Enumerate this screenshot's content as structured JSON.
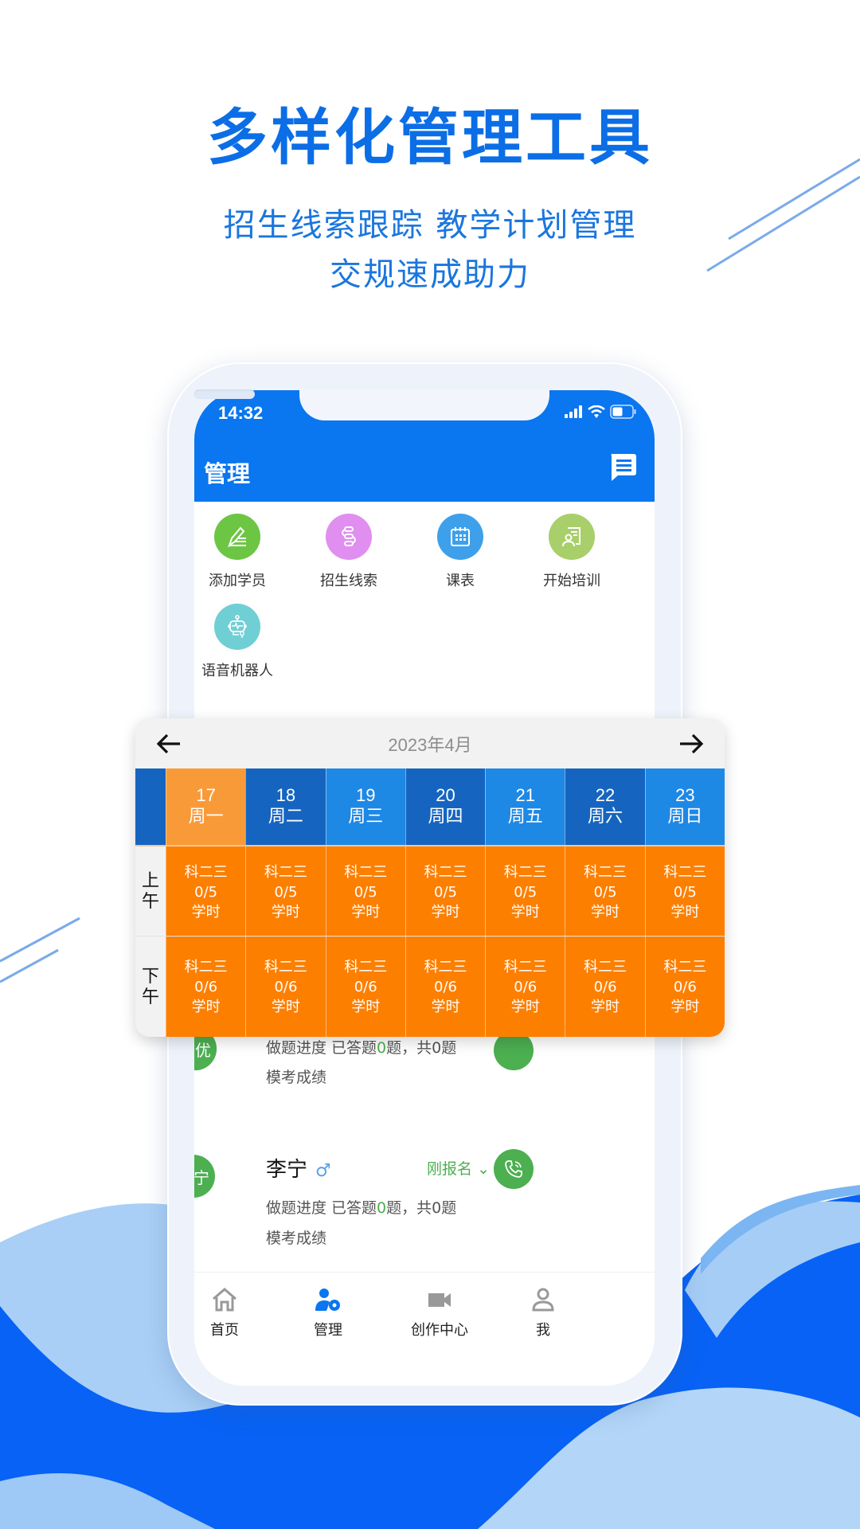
{
  "promo": {
    "headline": "多样化管理工具",
    "subline1": "招生线索跟踪 教学计划管理",
    "subline2": "交规速成助力",
    "brand_color": "#0b6ee6"
  },
  "status_bar": {
    "time": "14:32",
    "icons": [
      "signal-icon",
      "wifi-icon",
      "battery-icon"
    ]
  },
  "app_bar": {
    "title": "管理",
    "message_icon": "message-icon",
    "color": "#0a76f0"
  },
  "quick_actions": [
    {
      "label": "添加学员",
      "icon": "pen-list-icon",
      "color": "#6cc644"
    },
    {
      "label": "招生线索",
      "icon": "flow-icon",
      "color": "#e08ef0"
    },
    {
      "label": "课表",
      "icon": "calendar-icon",
      "color": "#3ea0ea"
    },
    {
      "label": "开始培训",
      "icon": "trainer-doc-icon",
      "color": "#a8cf6a"
    },
    {
      "label": "语音机器人",
      "icon": "robot-icon",
      "color": "#6fcfd4"
    }
  ],
  "calendar": {
    "month_label": "2023年4月",
    "prev_icon": "arrow-left-icon",
    "next_icon": "arrow-right-icon",
    "days": [
      {
        "date": "17",
        "weekday": "周一",
        "selected": true
      },
      {
        "date": "18",
        "weekday": "周二",
        "selected": false
      },
      {
        "date": "19",
        "weekday": "周三",
        "selected": false
      },
      {
        "date": "20",
        "weekday": "周四",
        "selected": false
      },
      {
        "date": "21",
        "weekday": "周五",
        "selected": false
      },
      {
        "date": "22",
        "weekday": "周六",
        "selected": false
      },
      {
        "date": "23",
        "weekday": "周日",
        "selected": false
      }
    ],
    "slots": [
      {
        "label": "上午",
        "cells": [
          {
            "subject": "科二三",
            "count": "0/5",
            "unit": "学时"
          },
          {
            "subject": "科二三",
            "count": "0/5",
            "unit": "学时"
          },
          {
            "subject": "科二三",
            "count": "0/5",
            "unit": "学时"
          },
          {
            "subject": "科二三",
            "count": "0/5",
            "unit": "学时"
          },
          {
            "subject": "科二三",
            "count": "0/5",
            "unit": "学时"
          },
          {
            "subject": "科二三",
            "count": "0/5",
            "unit": "学时"
          },
          {
            "subject": "科二三",
            "count": "0/5",
            "unit": "学时"
          }
        ]
      },
      {
        "label": "下午",
        "cells": [
          {
            "subject": "科二三",
            "count": "0/6",
            "unit": "学时"
          },
          {
            "subject": "科二三",
            "count": "0/6",
            "unit": "学时"
          },
          {
            "subject": "科二三",
            "count": "0/6",
            "unit": "学时"
          },
          {
            "subject": "科二三",
            "count": "0/6",
            "unit": "学时"
          },
          {
            "subject": "科二三",
            "count": "0/6",
            "unit": "学时"
          },
          {
            "subject": "科二三",
            "count": "0/6",
            "unit": "学时"
          },
          {
            "subject": "科二三",
            "count": "0/6",
            "unit": "学时"
          }
        ]
      }
    ],
    "colors": {
      "selected": "#f99a38",
      "dark_blue": "#1565c0",
      "light_blue": "#1e88e5",
      "slot": "#fd7f00"
    }
  },
  "students": [
    {
      "avatar_text": "李优",
      "progress_prefix": "做题进度 已答题",
      "answered": "0",
      "progress_suffix": "题，共0题",
      "mock_label": "模考成绩"
    },
    {
      "avatar_text": "李宁",
      "name": "李宁",
      "gender_symbol": "♂",
      "status": "刚报名",
      "progress_prefix": "做题进度 已答题",
      "answered": "0",
      "progress_suffix": "题，共0题",
      "mock_label": "模考成绩"
    }
  ],
  "tabbar": [
    {
      "label": "首页",
      "icon": "home-icon",
      "active": false
    },
    {
      "label": "管理",
      "icon": "user-settings-icon",
      "active": true
    },
    {
      "label": "创作中心",
      "icon": "video-camera-icon",
      "active": false
    },
    {
      "label": "我",
      "icon": "person-icon",
      "active": false
    }
  ]
}
